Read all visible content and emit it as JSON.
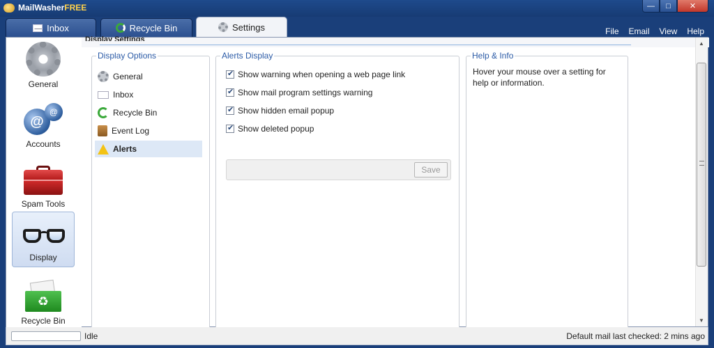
{
  "app": {
    "title_main": "MailWasher",
    "title_suffix": "FREE"
  },
  "window_controls": {
    "minimize": "—",
    "maximize": "□",
    "close": "✕"
  },
  "tabs": [
    {
      "label": "Inbox",
      "icon": "envelope-icon"
    },
    {
      "label": "Recycle Bin",
      "icon": "recycle-icon"
    },
    {
      "label": "Settings",
      "icon": "gear-icon",
      "active": true
    }
  ],
  "menus": [
    "File",
    "Email",
    "View",
    "Help"
  ],
  "section_title": "Display Settings",
  "leftnav": [
    {
      "label": "General",
      "icon": "gear-icon"
    },
    {
      "label": "Accounts",
      "icon": "accounts-icon"
    },
    {
      "label": "Spam Tools",
      "icon": "toolbox-icon"
    },
    {
      "label": "Display",
      "icon": "glasses-icon",
      "active": true
    },
    {
      "label": "Recycle Bin",
      "icon": "recycle-bin-icon"
    }
  ],
  "display_options": {
    "title": "Display Options",
    "items": [
      {
        "label": "General",
        "icon": "gear-icon"
      },
      {
        "label": "Inbox",
        "icon": "envelope-icon"
      },
      {
        "label": "Recycle Bin",
        "icon": "recycle-icon"
      },
      {
        "label": "Event Log",
        "icon": "log-icon"
      },
      {
        "label": "Alerts",
        "icon": "warning-icon",
        "active": true
      }
    ]
  },
  "alerts_display": {
    "title": "Alerts Display",
    "checkboxes": [
      {
        "label": "Show warning when opening a web page link",
        "checked": true
      },
      {
        "label": "Show mail program settings warning",
        "checked": true
      },
      {
        "label": "Show hidden email popup",
        "checked": true
      },
      {
        "label": "Show deleted popup",
        "checked": true
      }
    ],
    "save_label": "Save"
  },
  "help": {
    "title": "Help & Info",
    "text": "Hover your mouse over a setting for help or information."
  },
  "status": {
    "left": "Idle",
    "right": "Default mail last checked: 2 mins ago"
  },
  "colors": {
    "chrome_blue": "#1a3f7a",
    "group_title_blue": "#2a5aa6",
    "selected_bg": "#dde8f6"
  }
}
